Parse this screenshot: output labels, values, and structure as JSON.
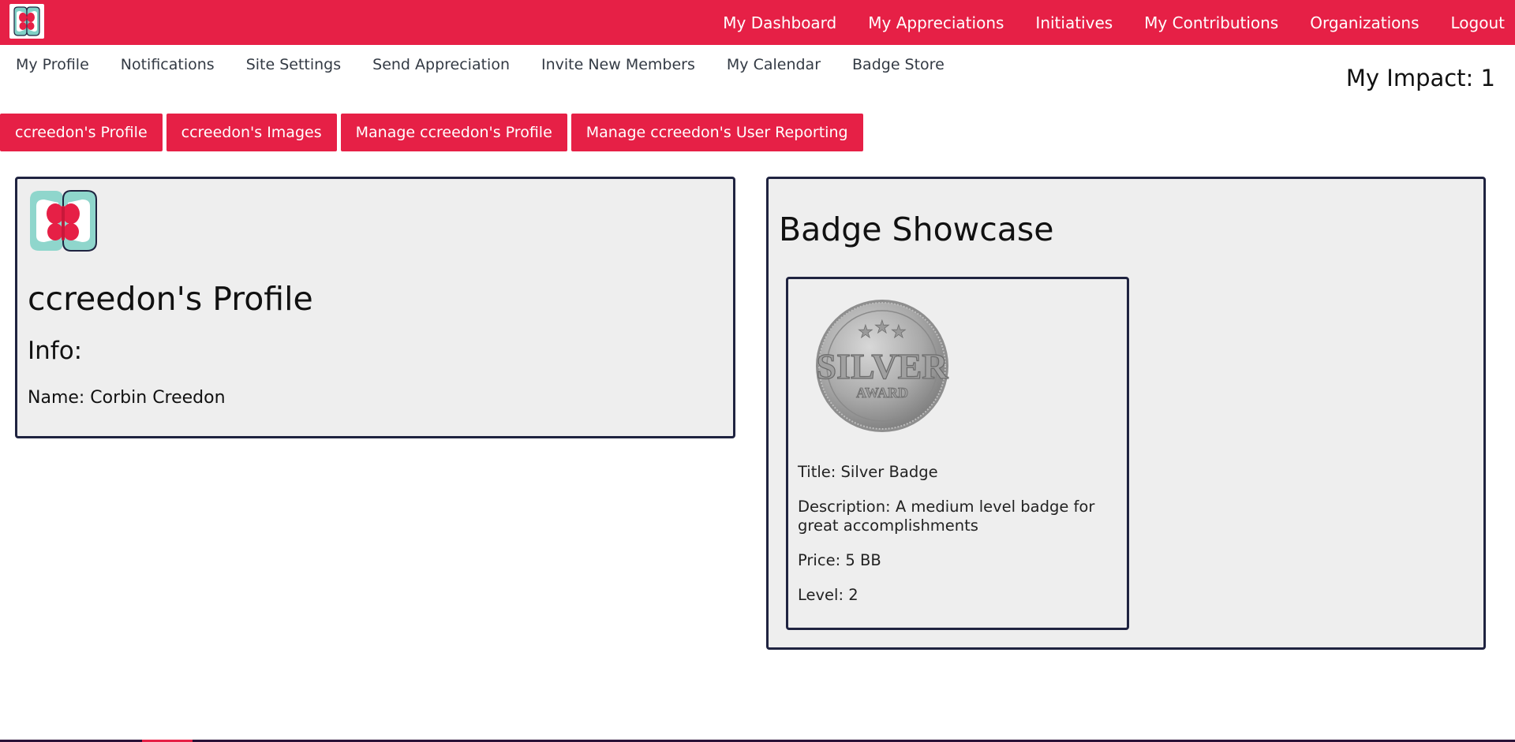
{
  "app": {
    "logo_icon": "butterfly-logo-icon",
    "brand_color": "#e62046",
    "border_color": "#1f2340",
    "card_bg": "#eeeeee"
  },
  "topnav": {
    "items": [
      "My Dashboard",
      "My Appreciations",
      "Initiatives",
      "My Contributions",
      "Organizations",
      "Logout"
    ]
  },
  "subnav": {
    "items": [
      "My Profile",
      "Notifications",
      "Site Settings",
      "Send Appreciation",
      "Invite New Members",
      "My Calendar",
      "Badge Store"
    ]
  },
  "impact": {
    "label": "My Impact: 1"
  },
  "tabs": [
    "ccreedon's Profile",
    "ccreedon's Images",
    "Manage ccreedon's Profile",
    "Manage ccreedon's User Reporting"
  ],
  "profile": {
    "avatar_icon": "butterfly-avatar-icon",
    "title": "ccreedon's Profile",
    "info_heading": "Info:",
    "name_line": "Name: Corbin Creedon"
  },
  "showcase": {
    "title": "Badge Showcase",
    "badges": [
      {
        "image_icon": "silver-award-medal-icon",
        "image_text_main": "SILVER",
        "image_text_sub": "AWARD",
        "title": "Title: Silver Badge",
        "description": "Description: A medium level badge for great accomplishments",
        "price": "Price: 5 BB",
        "level": "Level: 2"
      }
    ]
  }
}
